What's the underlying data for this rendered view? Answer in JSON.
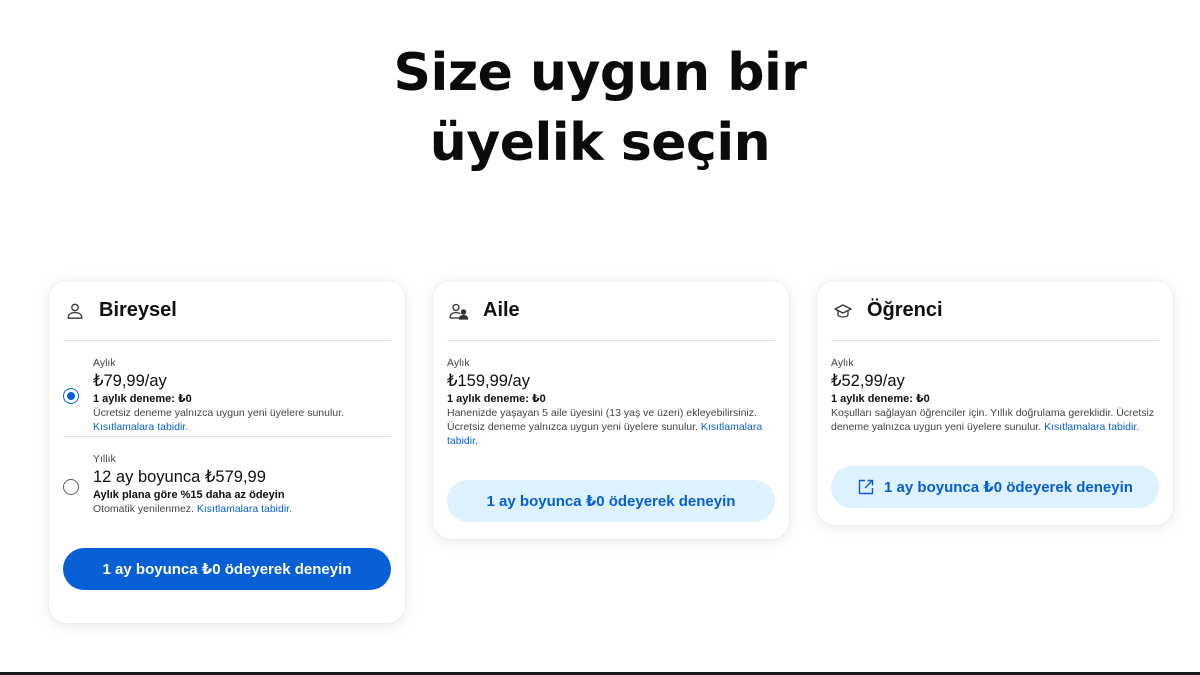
{
  "headline": {
    "line1": "Size uygun bir",
    "line2": "üyelik seçin"
  },
  "cards": [
    {
      "title": "Bireysel",
      "icon": "person-icon",
      "monthly": {
        "period": "Aylık",
        "price": "₺79,99/ay",
        "trial": "1 aylık deneme: ₺0",
        "note": "Ücretsiz deneme yalnızca uygun yeni üyelere sunulur.",
        "link": "Kısıtlamalara tabidir.",
        "selected": true
      },
      "yearly": {
        "period": "Yıllık",
        "price": "12 ay boyunca ₺579,99",
        "trial": "Aylık plana göre %15 daha az ödeyin",
        "note": "Otomatik yenilenmez.",
        "link": "Kısıtlamalara tabidir.",
        "selected": false
      },
      "button": "1 ay boyunca ₺0 ödeyerek deneyin"
    },
    {
      "title": "Aile",
      "icon": "family-icon",
      "period": "Aylık",
      "price": "₺159,99/ay",
      "trial": "1 aylık deneme: ₺0",
      "note": "Hanenizde yaşayan 5 aile üyesini (13 yaş ve üzeri) ekleyebilirsiniz. Ücretsiz deneme yalnızca uygun yeni üyelere sunulur.",
      "link": "Kısıtlamalara tabidir.",
      "button": "1 ay boyunca ₺0 ödeyerek deneyin"
    },
    {
      "title": "Öğrenci",
      "icon": "graduation-cap-icon",
      "period": "Aylık",
      "price": "₺52,99/ay",
      "trial": "1 aylık deneme: ₺0",
      "note": "Koşulları sağlayan öğrenciler için. Yıllık doğrulama gereklidir. Ücretsiz deneme yalnızca uygun yeni üyelere sunulur.",
      "link": "Kısıtlamalara tabidir.",
      "button": "1 ay boyunca ₺0 ödeyerek deneyin",
      "button_icon": "external-link-icon"
    }
  ],
  "colors": {
    "accent": "#065fd4",
    "secondary_button_bg": "#def1ff"
  }
}
